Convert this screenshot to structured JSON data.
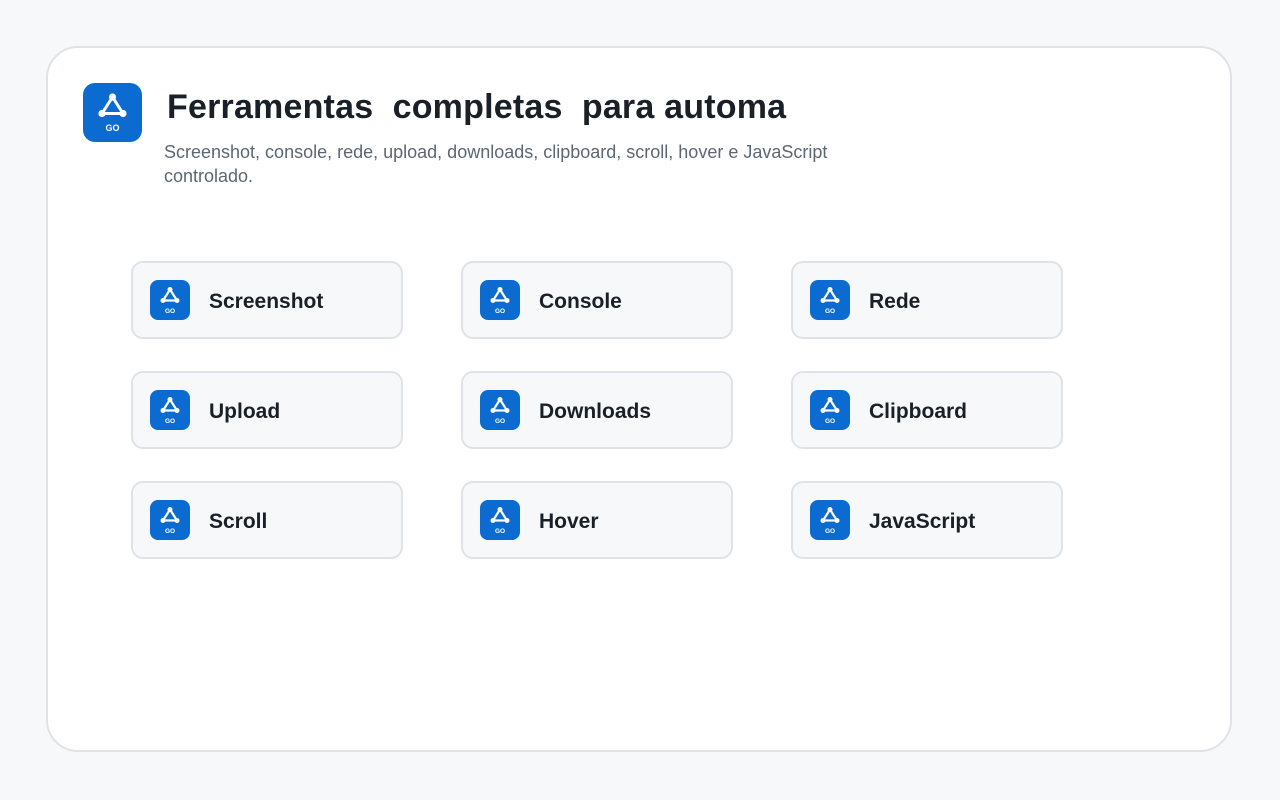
{
  "header": {
    "title": "Ferramentas  completas  para automa",
    "subtitle": "Screenshot, console, rede, upload, downloads, clipboard, scroll, hover e JavaScript controlado.",
    "logo_icon": "go-network-icon",
    "logo_text": "GO"
  },
  "colors": {
    "accent": "#0b6bd1",
    "background": "#f6f8fa",
    "panel": "#ffffff",
    "card_border": "#dfe3e8"
  },
  "features": [
    {
      "label": "Screenshot",
      "icon": "go-network-icon"
    },
    {
      "label": "Console",
      "icon": "go-network-icon"
    },
    {
      "label": "Rede",
      "icon": "go-network-icon"
    },
    {
      "label": "Upload",
      "icon": "go-network-icon"
    },
    {
      "label": "Downloads",
      "icon": "go-network-icon"
    },
    {
      "label": "Clipboard",
      "icon": "go-network-icon"
    },
    {
      "label": "Scroll",
      "icon": "go-network-icon"
    },
    {
      "label": "Hover",
      "icon": "go-network-icon"
    },
    {
      "label": "JavaScript",
      "icon": "go-network-icon"
    }
  ]
}
